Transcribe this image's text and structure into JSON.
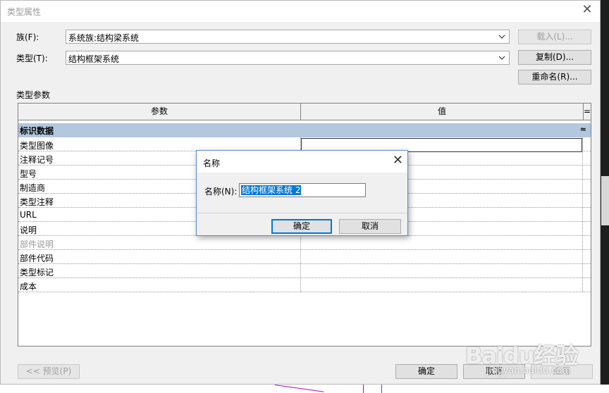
{
  "window": {
    "title": "类型属性"
  },
  "family": {
    "label": "族(F):",
    "value": "系统族:结构梁系统"
  },
  "type": {
    "label": "类型(T):",
    "value": "结构框架系统"
  },
  "buttons": {
    "load": "载入(L)...",
    "duplicate": "复制(D)...",
    "rename": "重命名(R)...",
    "preview": "<< 预览(P)",
    "ok": "确定",
    "cancel": "取消",
    "apply": "应用"
  },
  "section_label": "类型参数",
  "table": {
    "headers": {
      "param": "参数",
      "value": "值",
      "eq": "="
    },
    "group": {
      "label": "标识数据",
      "caret": "≈"
    },
    "rows": [
      {
        "param": "类型图像",
        "dim": false
      },
      {
        "param": "注释记号",
        "dim": false
      },
      {
        "param": "型号",
        "dim": false
      },
      {
        "param": "制造商",
        "dim": false
      },
      {
        "param": "类型注释",
        "dim": false
      },
      {
        "param": "URL",
        "dim": false
      },
      {
        "param": "说明",
        "dim": false
      },
      {
        "param": "部件说明",
        "dim": true
      },
      {
        "param": "部件代码",
        "dim": false
      },
      {
        "param": "类型标记",
        "dim": false
      },
      {
        "param": "成本",
        "dim": false
      }
    ]
  },
  "dialog": {
    "title": "名称",
    "name_label": "名称(N):",
    "name_value": "结构框架系统 2",
    "ok": "确定",
    "cancel": "取消"
  },
  "watermark": {
    "logo": "Baidu经验",
    "url": "jingyan.baidu.com"
  },
  "colors": {
    "group_bg": "#b3c7de",
    "selection": "#0078d7",
    "focus_border": "#0078d7"
  },
  "icons": {
    "close": "close-icon",
    "dropdown": "chevron-down-icon"
  }
}
